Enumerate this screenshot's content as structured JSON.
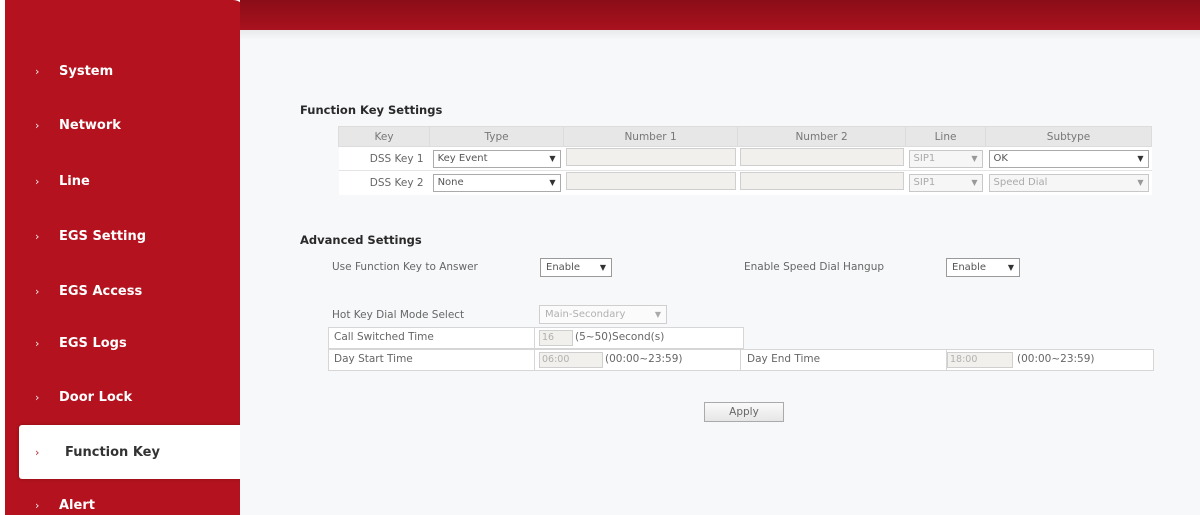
{
  "sidebar": {
    "items": [
      {
        "label": "System"
      },
      {
        "label": "Network"
      },
      {
        "label": "Line"
      },
      {
        "label": "EGS Setting"
      },
      {
        "label": "EGS Access"
      },
      {
        "label": "EGS Logs"
      },
      {
        "label": "Door Lock"
      },
      {
        "label": "Function Key",
        "active": true
      },
      {
        "label": "Alert"
      }
    ],
    "chevron": "›"
  },
  "function_keys": {
    "title": "Function Key Settings",
    "columns": [
      "Key",
      "Type",
      "Number 1",
      "Number 2",
      "Line",
      "Subtype"
    ],
    "rows": [
      {
        "key": "DSS Key 1",
        "type": "Key Event",
        "number1": "",
        "number2": "",
        "line": "SIP1",
        "subtype": "OK"
      },
      {
        "key": "DSS Key 2",
        "type": "None",
        "number1": "",
        "number2": "",
        "line": "SIP1",
        "subtype": "Speed Dial"
      }
    ]
  },
  "advanced": {
    "title": "Advanced Settings",
    "use_fk_answer_label": "Use Function Key to Answer",
    "use_fk_answer_value": "Enable",
    "speed_dial_hangup_label": "Enable Speed Dial Hangup",
    "speed_dial_hangup_value": "Enable",
    "hotkey_mode_label": "Hot Key Dial Mode Select",
    "hotkey_mode_value": "Main-Secondary",
    "call_switched_label": "Call Switched Time",
    "call_switched_value": "16",
    "call_switched_hint": "(5~50)Second(s)",
    "day_start_label": "Day Start Time",
    "day_start_value": "06:00",
    "day_start_hint": "(00:00~23:59)",
    "day_end_label": "Day End Time",
    "day_end_value": "18:00",
    "day_end_hint": "(00:00~23:59)"
  },
  "apply_label": "Apply",
  "colors": {
    "brand_red": "#b3121e",
    "banner_dark": "#8a0d17"
  }
}
